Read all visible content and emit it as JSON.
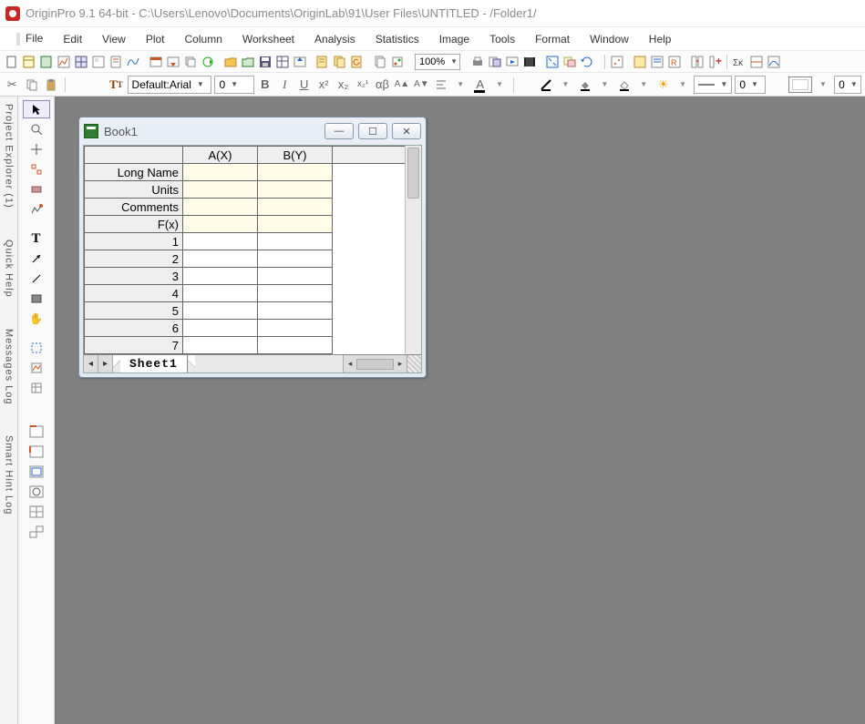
{
  "title": "OriginPro 9.1 64-bit - C:\\Users\\Lenovo\\Documents\\OriginLab\\91\\User Files\\UNTITLED - /Folder1/",
  "menu": [
    "File",
    "Edit",
    "View",
    "Plot",
    "Column",
    "Worksheet",
    "Analysis",
    "Statistics",
    "Image",
    "Tools",
    "Format",
    "Window",
    "Help"
  ],
  "zoom": "100%",
  "font_prefix": "Default: ",
  "font_name": "Arial",
  "font_size": "0",
  "line_width": "0",
  "swatch_width": "0",
  "dock": {
    "explorer": "Project Explorer (1)",
    "quick": "Quick Help",
    "messages": "Messages Log",
    "hint": "Smart Hint Log"
  },
  "book": {
    "title": "Book1",
    "columns": [
      "A(X)",
      "B(Y)"
    ],
    "meta_rows": [
      "Long Name",
      "Units",
      "Comments",
      "F(x)"
    ],
    "data_rows": [
      "1",
      "2",
      "3",
      "4",
      "5",
      "6",
      "7"
    ],
    "sheet": "Sheet1"
  }
}
